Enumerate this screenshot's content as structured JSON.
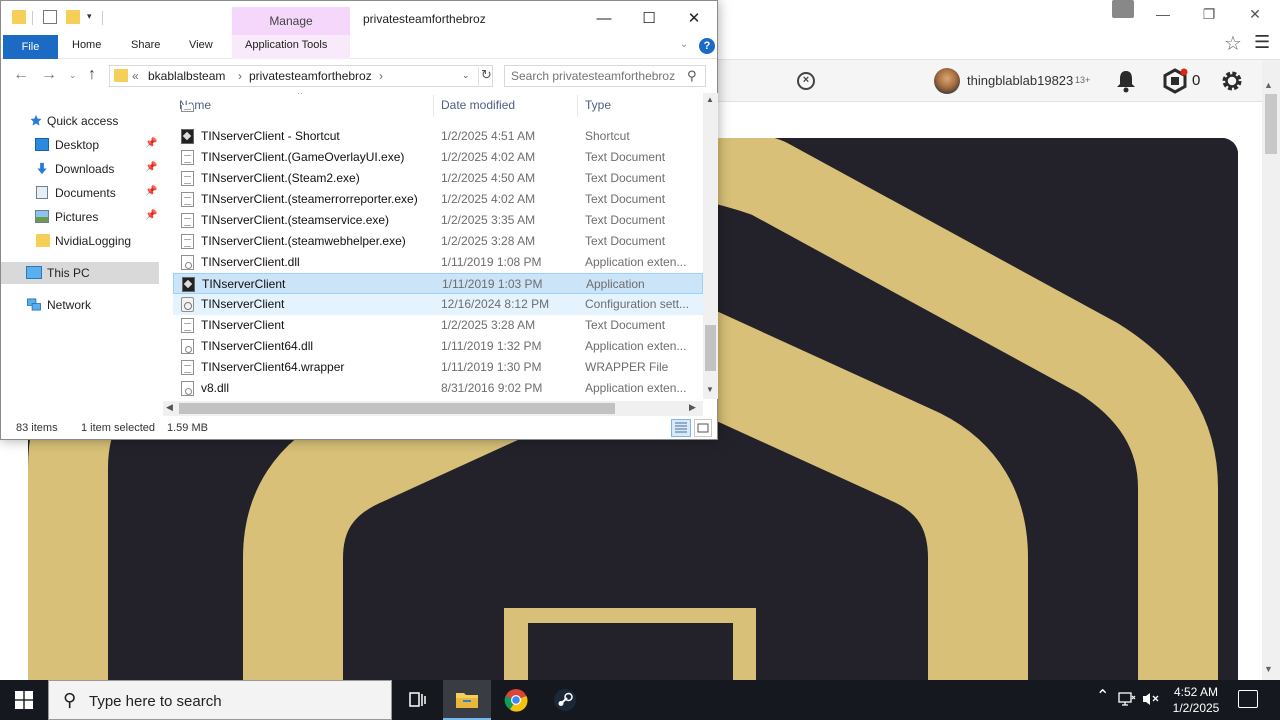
{
  "browser": {
    "minimize_glyph": "—",
    "restore_glyph": "❐",
    "close_glyph": "✕",
    "star_glyph": "☆",
    "menu_glyph": "☰",
    "clear_glyph": "×",
    "username": "thingblablab19823",
    "age_badge": "13+",
    "robux_count": "0",
    "scroll_up": "▲",
    "scroll_down": "▼"
  },
  "explorer": {
    "quick_access_dropdown": "▾",
    "context_tab": "Manage",
    "window_title": "privatesteamforthebroz",
    "window_controls": {
      "minimize": "—",
      "maximize": "☐",
      "close": "✕"
    },
    "ribbon": {
      "file": "File",
      "tabs": [
        "Home",
        "Share",
        "View"
      ],
      "context_subtab": "Application Tools",
      "expand_glyph": "⌄",
      "help_glyph": "?"
    },
    "nav": {
      "back": "←",
      "forward": "→",
      "recent": "⌄",
      "up": "↑",
      "overflow": "«",
      "crumbs": [
        "bkablalbsteam",
        "privatesteamforthebroz"
      ],
      "crumb_sep": "›",
      "dropdown": "⌄",
      "refresh": "↻"
    },
    "search": {
      "placeholder": "Search privatesteamforthebroz",
      "icon": "⚲"
    },
    "navpane": {
      "items": [
        {
          "label": "Quick access"
        },
        {
          "label": "Desktop",
          "pin": "📌"
        },
        {
          "label": "Downloads",
          "pin": "📌"
        },
        {
          "label": "Documents",
          "pin": "📌"
        },
        {
          "label": "Pictures",
          "pin": "📌"
        },
        {
          "label": "NvidiaLogging"
        },
        {
          "label": "This PC"
        },
        {
          "label": "Network"
        }
      ]
    },
    "columns": {
      "name": "Name",
      "date": "Date modified",
      "type": "Type",
      "sort_glyph": "^"
    },
    "files": [
      {
        "name": "TINserverClient - Shortcut",
        "date": "1/2/2025 4:51 AM",
        "type": "Shortcut",
        "icon": "app-icon"
      },
      {
        "name": "TINserverClient.(GameOverlayUI.exe)",
        "date": "1/2/2025 4:02 AM",
        "type": "Text Document",
        "icon": "text-document-icon"
      },
      {
        "name": "TINserverClient.(Steam2.exe)",
        "date": "1/2/2025 4:50 AM",
        "type": "Text Document",
        "icon": "text-document-icon"
      },
      {
        "name": "TINserverClient.(steamerrorreporter.exe)",
        "date": "1/2/2025 4:02 AM",
        "type": "Text Document",
        "icon": "text-document-icon"
      },
      {
        "name": "TINserverClient.(steamservice.exe)",
        "date": "1/2/2025 3:35 AM",
        "type": "Text Document",
        "icon": "text-document-icon"
      },
      {
        "name": "TINserverClient.(steamwebhelper.exe)",
        "date": "1/2/2025 3:28 AM",
        "type": "Text Document",
        "icon": "text-document-icon"
      },
      {
        "name": "TINserverClient.dll",
        "date": "1/11/2019 1:08 PM",
        "type": "Application exten...",
        "icon": "dll-icon"
      },
      {
        "name": "TINserverClient",
        "date": "1/11/2019 1:03 PM",
        "type": "Application",
        "icon": "app-icon"
      },
      {
        "name": "TINserverClient",
        "date": "12/16/2024 8:12 PM",
        "type": "Configuration sett...",
        "icon": "config-file-icon"
      },
      {
        "name": "TINserverClient",
        "date": "1/2/2025 3:28 AM",
        "type": "Text Document",
        "icon": "text-document-icon"
      },
      {
        "name": "TINserverClient64.dll",
        "date": "1/11/2019 1:32 PM",
        "type": "Application exten...",
        "icon": "dll-icon"
      },
      {
        "name": "TINserverClient64.wrapper",
        "date": "1/11/2019 1:30 PM",
        "type": "WRAPPER File",
        "icon": "text-document-icon"
      },
      {
        "name": "v8.dll",
        "date": "8/31/2016 9:02 PM",
        "type": "Application exten...",
        "icon": "dll-icon"
      }
    ],
    "scroll": {
      "up": "▲",
      "down": "▼",
      "left": "◀",
      "right": "▶"
    },
    "status": {
      "item_count": "83 items",
      "selected": "1 item selected",
      "size": "1.59 MB"
    }
  },
  "taskbar": {
    "search_icon": "⚲",
    "search_placeholder": "Type here to search",
    "tray_chevron": "⌃",
    "time": "4:52 AM",
    "date": "1/2/2025"
  },
  "colors": {
    "accent": "#1b6bc4",
    "context_tab": "#f4d7fa",
    "selection": "#cce4f7",
    "taskbar": "#16181f",
    "logo_gold": "#d8c078",
    "logo_dark": "#23222b"
  }
}
